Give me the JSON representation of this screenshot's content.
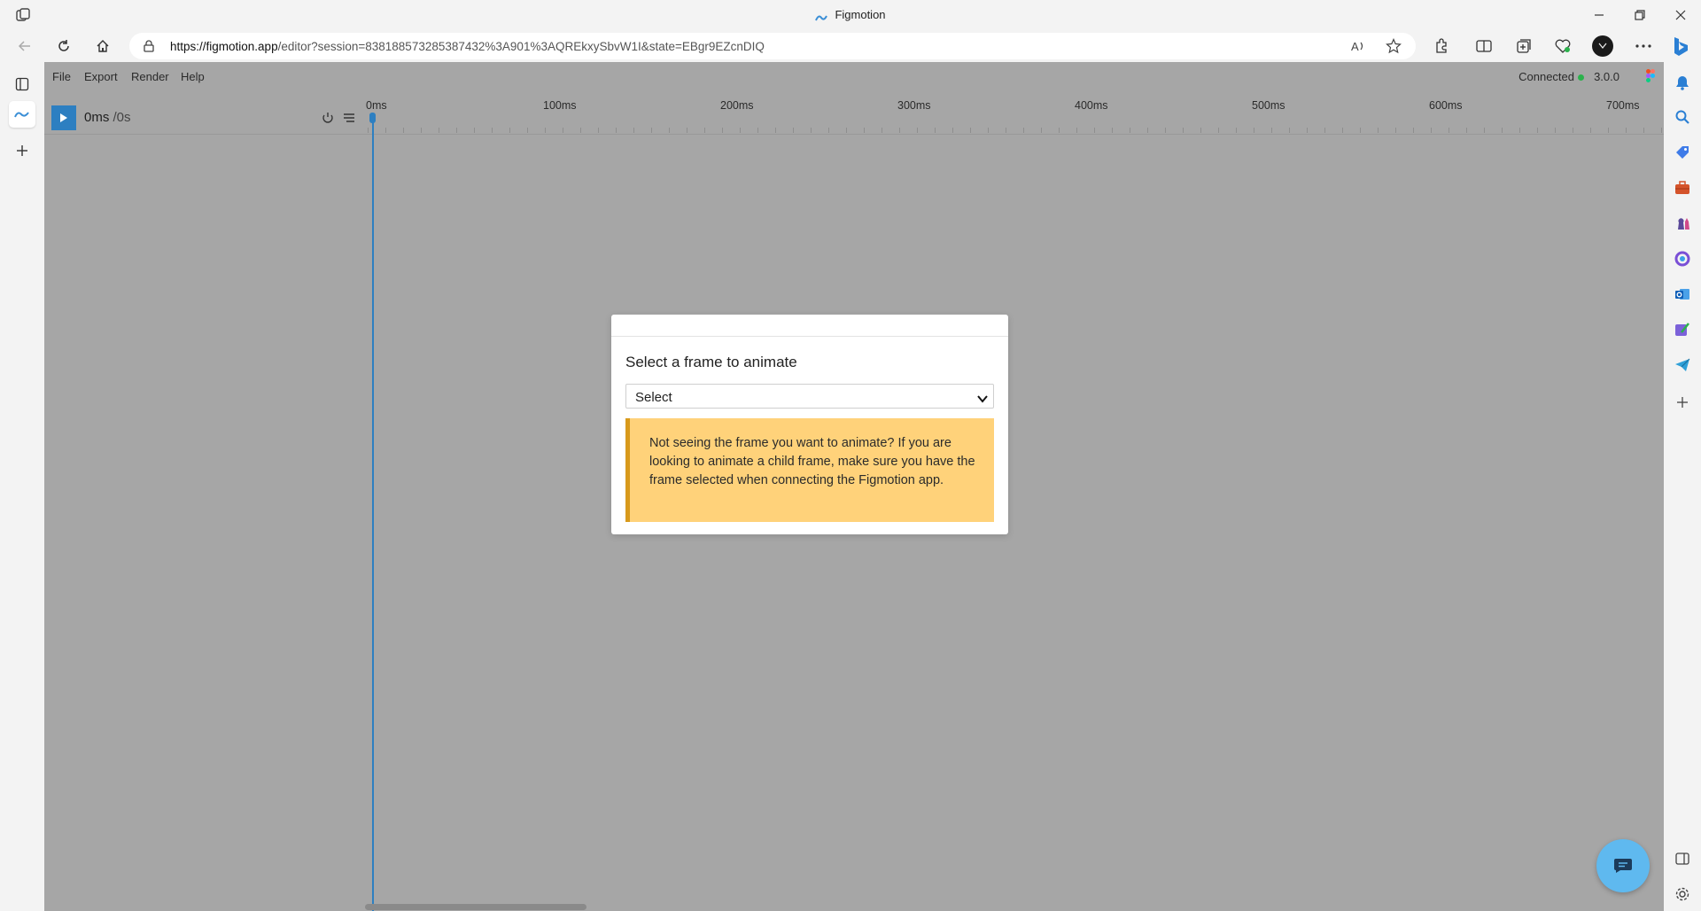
{
  "browser": {
    "window_title": "Figmotion",
    "url_host": "https://figmotion.app",
    "url_path": "/editor?session=838188573285387432%3A901%3AQREkxySbvW1I&state=EBgr9EZcnDIQ"
  },
  "menu": {
    "items": [
      "File",
      "Export",
      "Render",
      "Help"
    ],
    "status": "Connected",
    "version": "3.0.0"
  },
  "timeline": {
    "current": "0ms",
    "total": "/0s",
    "ruler_labels": [
      "0ms",
      "100ms",
      "200ms",
      "300ms",
      "400ms",
      "500ms",
      "600ms",
      "700ms"
    ]
  },
  "modal": {
    "title": "Select a frame to animate",
    "select_value": "Select",
    "warning": "Not seeing the frame you want to animate? If you are looking to animate a child frame, make sure you have the frame selected when connecting the Figmotion app."
  },
  "colors": {
    "accent": "#2d7fc1",
    "canvas": "#a6a6a6",
    "warning_bg": "#ffd27a",
    "warning_border": "#d89a1c",
    "status_dot": "#2bb24c"
  }
}
